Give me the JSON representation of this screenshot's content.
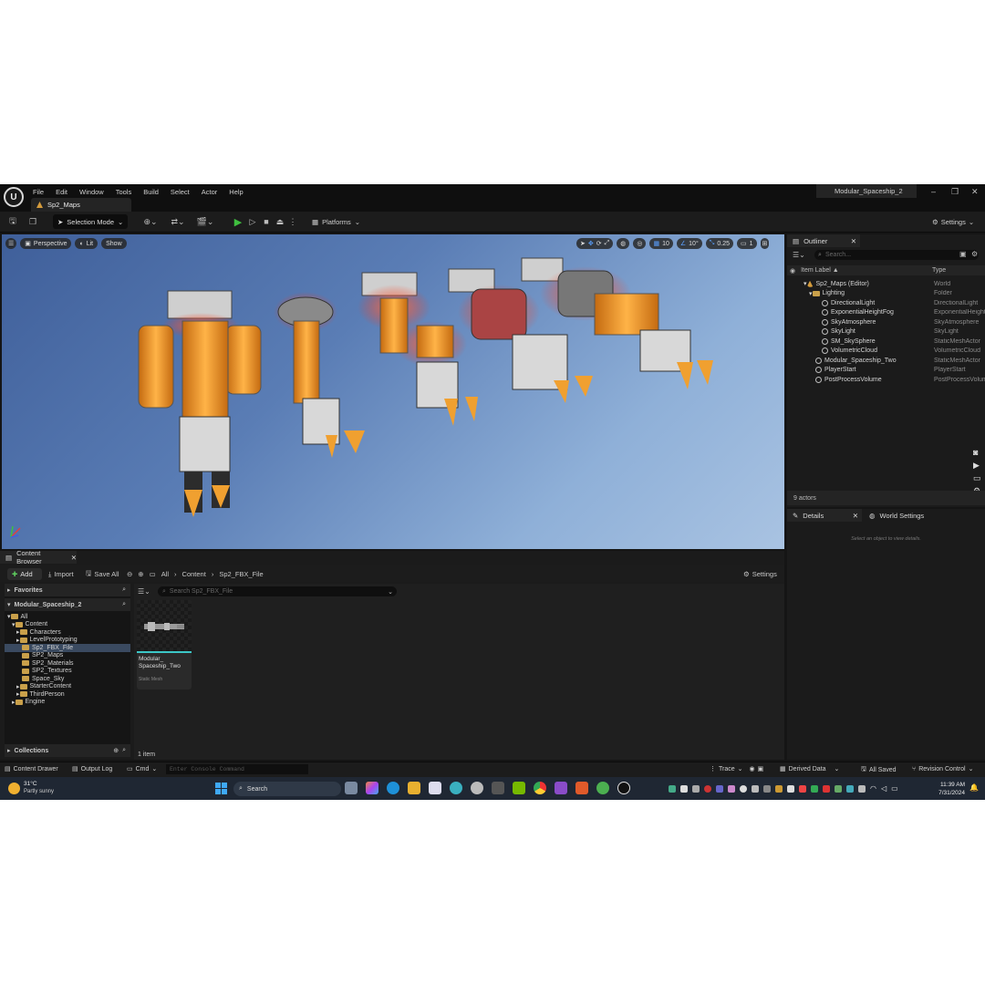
{
  "menu": [
    "File",
    "Edit",
    "Window",
    "Tools",
    "Build",
    "Select",
    "Actor",
    "Help"
  ],
  "map_tab": "Sp2_Maps",
  "project_name": "Modular_Spaceship_2",
  "toolbar": {
    "selection_mode": "Selection Mode",
    "platforms": "Platforms",
    "settings": "Settings"
  },
  "viewport": {
    "perspective": "Perspective",
    "lit": "Lit",
    "show": "Show",
    "grid_snap": "10",
    "rot_snap": "10°",
    "scale_snap": "0.25",
    "cam_speed": "1"
  },
  "outliner": {
    "title": "Outliner",
    "search_placeholder": "Search...",
    "col_label": "Item Label ▲",
    "col_type": "Type",
    "rows": [
      {
        "label": "Sp2_Maps (Editor)",
        "type": "World"
      },
      {
        "label": "Lighting",
        "type": "Folder"
      },
      {
        "label": "DirectionalLight",
        "type": "DirectionalLight"
      },
      {
        "label": "ExponentialHeightFog",
        "type": "ExponentialHeightFog"
      },
      {
        "label": "SkyAtmosphere",
        "type": "SkyAtmosphere"
      },
      {
        "label": "SkyLight",
        "type": "SkyLight"
      },
      {
        "label": "SM_SkySphere",
        "type": "StaticMeshActor"
      },
      {
        "label": "VolumetricCloud",
        "type": "VolumetricCloud"
      },
      {
        "label": "Modular_Spaceship_Two",
        "type": "StaticMeshActor"
      },
      {
        "label": "PlayerStart",
        "type": "PlayerStart"
      },
      {
        "label": "PostProcessVolume",
        "type": "PostProcessVolume"
      }
    ],
    "actors_count": "9 actors"
  },
  "details": {
    "tab1": "Details",
    "tab2": "World Settings",
    "empty_hint": "Select an object to view details."
  },
  "content_browser": {
    "tab": "Content Browser",
    "add": "Add",
    "import": "Import",
    "save_all": "Save All",
    "breadcrumb": [
      "All",
      "Content",
      "Sp2_FBX_File"
    ],
    "settings": "Settings",
    "search_placeholder": "Search Sp2_FBX_File",
    "favorites": "Favorites",
    "project": "Modular_Spaceship_2",
    "tree": [
      "All",
      "Content",
      "Characters",
      "LevelPrototyping",
      "Sp2_FBX_File",
      "SP2_Maps",
      "SP2_Materials",
      "SP2_Textures",
      "Space_Sky",
      "StarterContent",
      "ThirdPerson",
      "Engine"
    ],
    "collections": "Collections",
    "asset_name": "Modular_ Spaceship_Two",
    "asset_type": "Static Mesh",
    "item_count": "1 item"
  },
  "statusbar": {
    "content_drawer": "Content Drawer",
    "output_log": "Output Log",
    "cmd": "Cmd",
    "console_placeholder": "Enter Console Command",
    "trace": "Trace",
    "derived_data": "Derived Data",
    "all_saved": "All Saved",
    "revision_control": "Revision Control"
  },
  "taskbar": {
    "temp": "31°C",
    "weather": "Partly sunny",
    "search": "Search",
    "time": "11:39 AM",
    "date": "7/31/2024"
  }
}
